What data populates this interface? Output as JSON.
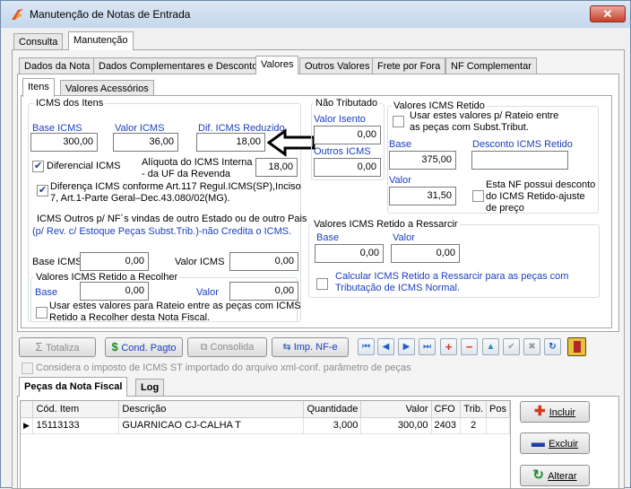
{
  "window": {
    "title": "Manutenção de Notas de Entrada",
    "close_glyph": "✕"
  },
  "main_tabs": [
    "Consulta",
    "Manutenção"
  ],
  "section_tabs": [
    "Dados da Nota",
    "Dados Complementares e Desconto",
    "Valores",
    "Outros Valores",
    "Frete por Fora",
    "NF Complementar"
  ],
  "sub_tabs": [
    "Itens",
    "Valores Acessórios"
  ],
  "icms_itens": {
    "title": "ICMS dos Itens",
    "base_icms_label": "Base ICMS",
    "base_icms_value": "300,00",
    "valor_icms_label": "Valor ICMS",
    "valor_icms_value": "36,00",
    "dif_icms_label": "Dif. ICMS Reduzido",
    "dif_icms_value": "18,00",
    "diferencial_label": "Diferencial ICMS",
    "aliquota_label_1": "Alíquota do ICMS Interna",
    "aliquota_label_2": "- da UF da Revenda",
    "aliquota_value": "18,00",
    "diferenca_label_1": "Diferença ICMS conforme Art.117 Regul.ICMS(SP),Inciso",
    "diferenca_label_2": "7, Art.1-Parte Geral–Dec.43.080/02(MG).",
    "outros_label": "ICMS Outros p/ NF´s vindas de outro Estado ou de outro Pais",
    "outros_note": "(p/ Rev. c/ Estoque Peças Subst.Trib.)-não Credita o ICMS.",
    "outros_base_label": "Base ICMS",
    "outros_base_value": "0,00",
    "outros_valor_label": "Valor ICMS",
    "outros_valor_value": "0,00"
  },
  "retido_recolher": {
    "title": "Valores ICMS Retido a Recolher",
    "base_label": "Base",
    "base_value": "0,00",
    "valor_label": "Valor",
    "valor_value": "0,00",
    "rateio_label_1": "Usar estes valores para Rateio entre as peças com ICMS",
    "rateio_label_2": "Retido a Recolher desta Nota Fiscal."
  },
  "nao_tributado": {
    "title": "Não Tributado",
    "valor_isento_label": "Valor Isento",
    "valor_isento_value": "0,00",
    "outros_icms_label": "Outros ICMS",
    "outros_icms_value": "0,00"
  },
  "retido": {
    "title": "Valores ICMS Retido",
    "rateio_label_1": "Usar estes valores p/ Rateio  entre",
    "rateio_label_2": "as peças com Subst.Tribut.",
    "base_label": "Base",
    "base_value": "375,00",
    "desconto_label": "Desconto ICMS Retido",
    "desconto_value": "",
    "valor_label": "Valor",
    "valor_value": "31,50",
    "desconto_chk_1": "Esta NF possui desconto",
    "desconto_chk_2": "do ICMS Retido-ajuste",
    "desconto_chk_3": "de preço"
  },
  "ressarcir": {
    "title": "Valores ICMS Retido a Ressarcir",
    "base_label": "Base",
    "base_value": "0,00",
    "valor_label": "Valor",
    "valor_value": "0,00",
    "calc_label_1": "Calcular ICMS Retido a  Ressarcir para as peças com",
    "calc_label_2": "Tributação de ICMS Normal."
  },
  "toolbar": {
    "totaliza": "Totaliza",
    "cond_pagto": "Cond. Pagto",
    "consolida": "Consolida",
    "imp_nfe": "Imp. NF-e"
  },
  "considera_label": "Considera o imposto de ICMS ST importado do arquivo xml-conf. parâmetro de peças",
  "bottom_tabs": [
    "Peças da Nota Fiscal",
    "Log"
  ],
  "grid": {
    "headers": [
      "Cód. Item",
      "Descrição",
      "Quantidade",
      "Valor",
      "CFO",
      "Trib.",
      "Pos"
    ],
    "rows": [
      [
        "15113133",
        "GUARNICAO CJ-CALHA T",
        "3,000",
        "300,00",
        "2403",
        "2",
        ""
      ]
    ]
  },
  "side_buttons": {
    "incluir": "Incluir",
    "excluir": "Excluir",
    "alterar": "Alterar"
  },
  "colors": {
    "accent_blue": "#1a3fbf",
    "title_gradient": "#c4d7ec",
    "close_red": "#c6402b"
  }
}
